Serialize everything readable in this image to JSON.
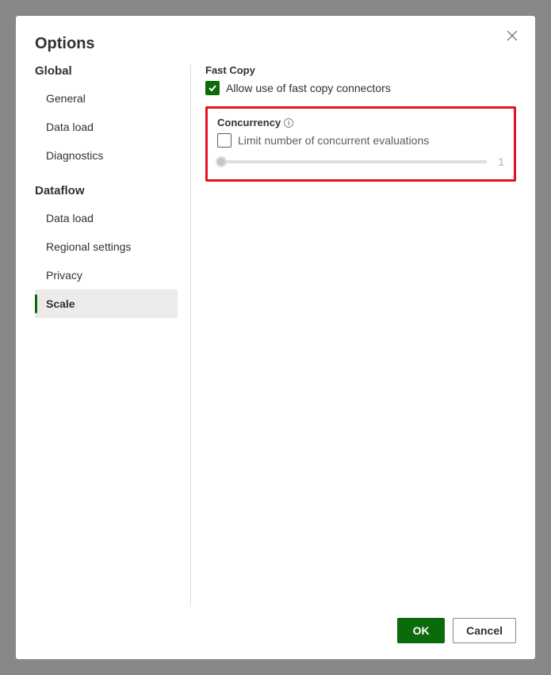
{
  "dialog": {
    "title": "Options"
  },
  "sidebar": {
    "global": {
      "header": "Global",
      "items": [
        "General",
        "Data load",
        "Diagnostics"
      ]
    },
    "dataflow": {
      "header": "Dataflow",
      "items": [
        "Data load",
        "Regional settings",
        "Privacy",
        "Scale"
      ],
      "selected": "Scale"
    }
  },
  "content": {
    "fastCopy": {
      "label": "Fast Copy",
      "checkbox": {
        "checked": true,
        "label": "Allow use of fast copy connectors"
      }
    },
    "concurrency": {
      "label": "Concurrency",
      "checkbox": {
        "checked": false,
        "label": "Limit number of concurrent evaluations"
      },
      "slider": {
        "value": "1"
      }
    }
  },
  "footer": {
    "ok": "OK",
    "cancel": "Cancel"
  }
}
